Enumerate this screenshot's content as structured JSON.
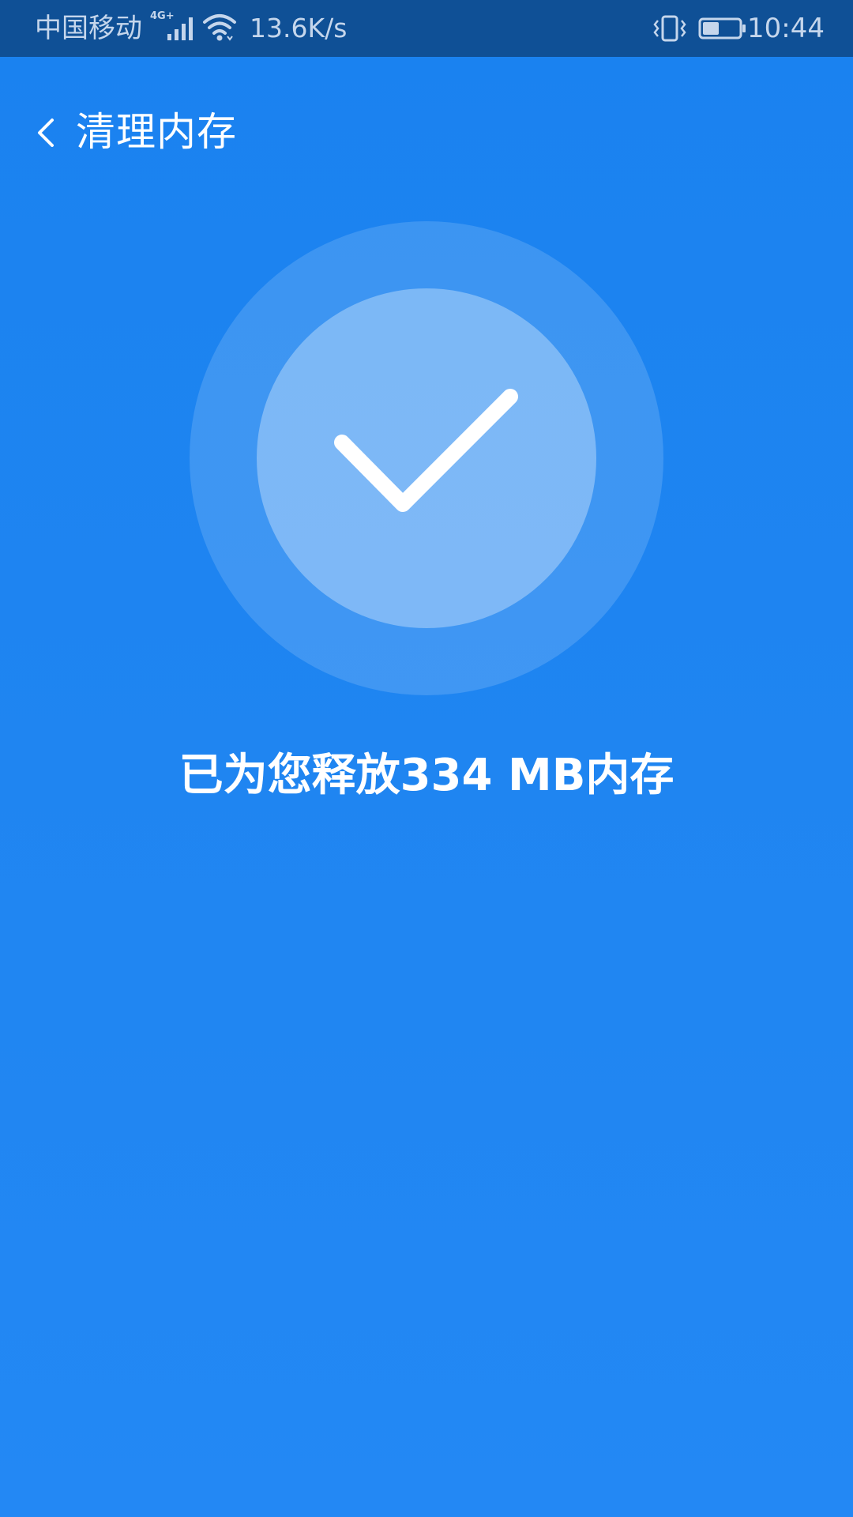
{
  "status_bar": {
    "carrier": "中国移动",
    "network_type": "4G+",
    "speed": "13.6K/s",
    "time": "10:44",
    "icons": [
      "signal-icon",
      "wifi-icon",
      "vibrate-icon",
      "battery-icon"
    ],
    "battery_level": 0.45
  },
  "header": {
    "back_icon": "chevron-left-icon",
    "title": "清理内存"
  },
  "result": {
    "icon": "checkmark-icon",
    "message": "已为您释放334 MB内存"
  },
  "colors": {
    "background": "#1f85f1",
    "status_bar": "#0f5096",
    "text": "#ffffff"
  }
}
